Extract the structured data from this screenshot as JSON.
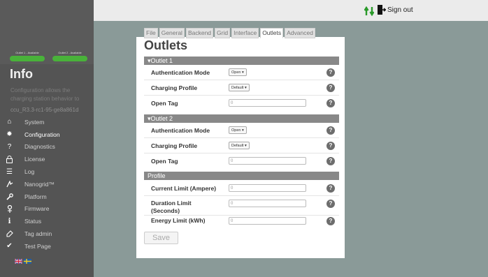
{
  "topbar": {
    "updown_icon": "up-down-arrows-icon",
    "signout_label": "Sign out",
    "signout_icon": "door-exit-icon",
    "accent_green": "#2a9a2a"
  },
  "sidebar": {
    "outlet_statuses": [
      {
        "label": "Outlet 1 - Available",
        "color": "#49b23a"
      },
      {
        "label": "Outlet 2 - Available",
        "color": "#49b23a"
      }
    ],
    "title": "Info",
    "description": "Configuration allows the charging station behavior to",
    "version": "ccu_R3.3-rc1-95-ge8a861d",
    "items": [
      {
        "label": "System",
        "icon": "home-icon"
      },
      {
        "label": "Configuration",
        "icon": "gear-icon"
      },
      {
        "label": "Diagnostics",
        "icon": "question-icon"
      },
      {
        "label": "License",
        "icon": "lock-icon"
      },
      {
        "label": "Log",
        "icon": "list-icon"
      },
      {
        "label": "Nanogrid™",
        "icon": "nanogrid-icon"
      },
      {
        "label": "Platform",
        "icon": "wrench-icon"
      },
      {
        "label": "Firmware",
        "icon": "usb-icon"
      },
      {
        "label": "Status",
        "icon": "info-icon"
      },
      {
        "label": "Tag admin",
        "icon": "tag-icon"
      },
      {
        "label": "Test Page",
        "icon": "check-icon"
      }
    ],
    "flags": [
      "uk-flag-icon",
      "sweden-flag-icon"
    ]
  },
  "tabs": [
    "File",
    "General",
    "Backend",
    "Grid",
    "Interface",
    "Outlets",
    "Advanced"
  ],
  "active_tab": "Outlets",
  "page_title": "Outlets",
  "sections": {
    "outlet1": {
      "title": "Outlet 1",
      "auth_label": "Authentication Mode",
      "auth_value": "Open ▾",
      "profile_label": "Charging Profile",
      "profile_value": "Default ▾",
      "tag_label": "Open Tag",
      "tag_value": "0"
    },
    "outlet2": {
      "title": "Outlet 2",
      "auth_label": "Authentication Mode",
      "auth_value": "Open ▾",
      "profile_label": "Charging Profile",
      "profile_value": "Default ▾",
      "tag_label": "Open Tag",
      "tag_value": "0"
    },
    "profile": {
      "title": "Profile",
      "current_label": "Current Limit (Ampere)",
      "current_value": "0",
      "duration_label": "Duration Limit (Seconds)",
      "duration_value": "0",
      "energy_label": "Energy Limit (kWh)",
      "energy_value": "0"
    }
  },
  "help_symbol": "?",
  "save_label": "Save"
}
